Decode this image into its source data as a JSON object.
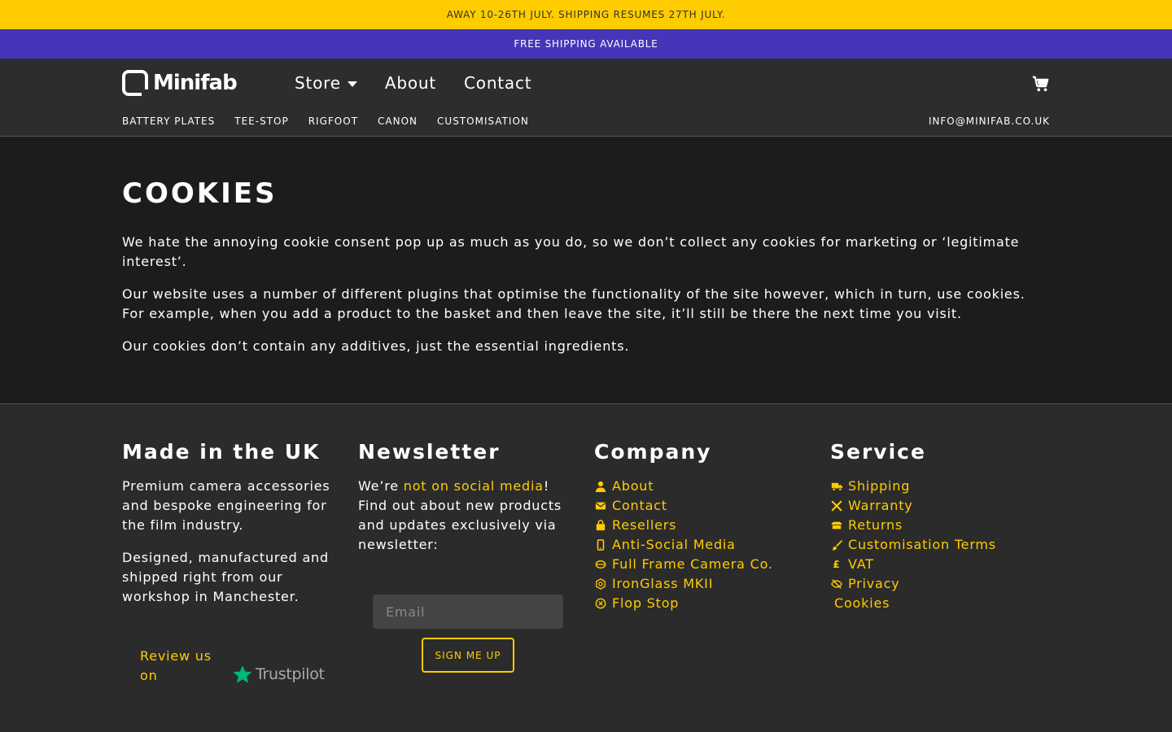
{
  "banners": {
    "top": "AWAY 10-26TH JULY. SHIPPING RESUMES 27TH JULY.",
    "secondary": "FREE SHIPPING AVAILABLE"
  },
  "header": {
    "logo_text": "Minifab",
    "nav": [
      {
        "label": "Store",
        "has_dropdown": true
      },
      {
        "label": "About"
      },
      {
        "label": "Contact"
      }
    ],
    "subnav": [
      "BATTERY PLATES",
      "TEE-STOP",
      "RIGFOOT",
      "CANON",
      "CUSTOMISATION"
    ],
    "email": "INFO@MINIFAB.CO.UK",
    "cart_icon": "cart-icon"
  },
  "main": {
    "title": "COOKIES",
    "paragraphs": [
      "We hate the annoying cookie consent pop up as much as you do, so we don’t collect any cookies for marketing or ‘legitimate interest’.",
      "Our website uses a number of different plugins that optimise the functionality of the site however, which in turn, use cookies. For example, when you add a product to the basket and then leave the site, it’ll still be there the next time you visit.",
      "Our cookies don’t contain any additives, just the essential ingredients."
    ]
  },
  "footer": {
    "uk": {
      "heading": "Made in the UK",
      "p1": "Premium camera accessories and bespoke engineering for the film industry.",
      "p2": "Designed, manufactured and shipped right from our workshop in Manchester.",
      "review": "Review us on",
      "trustpilot": "Trustpilot"
    },
    "newsletter": {
      "heading": "Newsletter",
      "pre": "We’re ",
      "link": "not on social media",
      "post": "! Find out about new products and updates exclusively via newsletter:",
      "placeholder": "Email",
      "button": "SIGN ME UP"
    },
    "company": {
      "heading": "Company",
      "links": [
        {
          "label": "About",
          "icon": "user-icon"
        },
        {
          "label": "Contact",
          "icon": "envelope-icon"
        },
        {
          "label": "Resellers",
          "icon": "bag-icon"
        },
        {
          "label": "Anti-Social Media",
          "icon": "phone-icon"
        },
        {
          "label": "Full Frame Camera Co.",
          "icon": "film-icon"
        },
        {
          "label": "IronGlass MKII",
          "icon": "lens-icon"
        },
        {
          "label": "Flop Stop",
          "icon": "circle-x-icon"
        }
      ]
    },
    "service": {
      "heading": "Service",
      "links": [
        {
          "label": "Shipping",
          "icon": "truck-icon"
        },
        {
          "label": "Warranty",
          "icon": "tools-icon"
        },
        {
          "label": "Returns",
          "icon": "box-icon"
        },
        {
          "label": "Customisation Terms",
          "icon": "brush-icon"
        },
        {
          "label": "VAT",
          "icon": "pound-icon"
        },
        {
          "label": "Privacy",
          "icon": "eye-slash-icon"
        },
        {
          "label": "Cookies",
          "icon": ""
        }
      ]
    }
  },
  "colors": {
    "accent": "#ffcc00",
    "banner_purple": "#4535b8",
    "background": "#2b2b2b",
    "content_bg": "#1c1c1c"
  }
}
